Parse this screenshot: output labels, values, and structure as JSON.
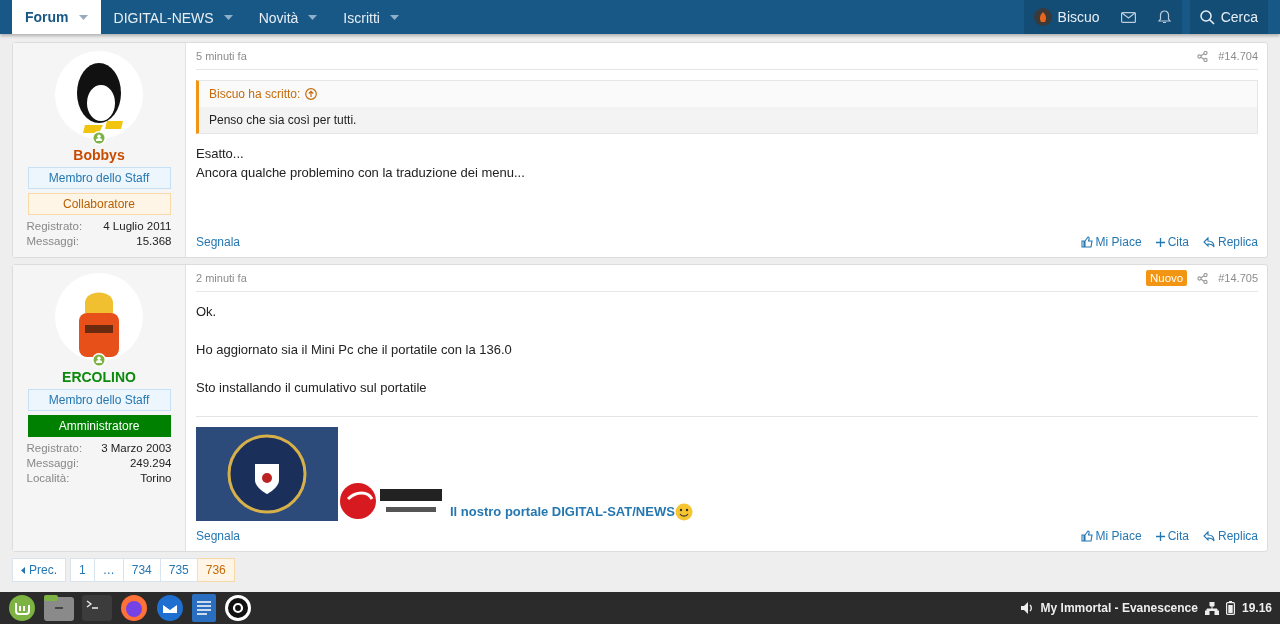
{
  "nav": {
    "tabs": [
      {
        "label": "Forum",
        "selected": true
      },
      {
        "label": "DIGITAL-NEWS",
        "selected": false
      },
      {
        "label": "Novità",
        "selected": false
      },
      {
        "label": "Iscritti",
        "selected": false
      }
    ],
    "user": {
      "name": "Biscuo"
    },
    "search": {
      "label": "Cerca"
    }
  },
  "posts": [
    {
      "author": {
        "name": "Bobbys",
        "color": "#c84b00",
        "online": true,
        "banners": [
          {
            "label": "Membro dello Staff",
            "kind": "staff"
          },
          {
            "label": "Collaboratore",
            "kind": "collab"
          }
        ],
        "stats": [
          {
            "label": "Registrato:",
            "value": "4 Luglio 2011"
          },
          {
            "label": "Messaggi:",
            "value": "15.368"
          }
        ]
      },
      "time": "5 minuti fa",
      "is_new": false,
      "number": "#14.704",
      "quote": {
        "author": "Biscuo ha scritto:",
        "text": "Penso che sia così per tutti."
      },
      "paragraphs": [
        "Esatto...\nAncora qualche problemino con la traduzione dei menu..."
      ],
      "actions": {
        "report": "Segnala",
        "like": "Mi Piace",
        "quote": "Cita",
        "reply": "Replica"
      }
    },
    {
      "author": {
        "name": "ERCOLINO",
        "color": "#0b8a0b",
        "online": true,
        "banners": [
          {
            "label": "Membro dello Staff",
            "kind": "staff"
          },
          {
            "label": "Amministratore",
            "kind": "admin"
          }
        ],
        "stats": [
          {
            "label": "Registrato:",
            "value": "3 Marzo 2003"
          },
          {
            "label": "Messaggi:",
            "value": "249.294"
          },
          {
            "label": "Località:",
            "value": "Torino"
          }
        ]
      },
      "time": "2 minuti fa",
      "is_new": true,
      "new_label": "Nuovo",
      "number": "#14.705",
      "paragraphs": [
        "Ok.",
        "Ho aggiornato sia il Mini Pc che il portatile con la 136.0",
        "Sto installando il cumulativo sul portatile"
      ],
      "signature": {
        "link": "Il nostro portale DIGITAL-SAT/NEWS"
      },
      "actions": {
        "report": "Segnala",
        "like": "Mi Piace",
        "quote": "Cita",
        "reply": "Replica"
      }
    }
  ],
  "pagination": {
    "prev": "Prec.",
    "pages": [
      {
        "label": "1",
        "selected": false
      },
      {
        "label": "…",
        "selected": false
      },
      {
        "label": "734",
        "selected": false
      },
      {
        "label": "735",
        "selected": false
      },
      {
        "label": "736",
        "selected": true
      }
    ]
  },
  "taskbar": {
    "now_playing": "My Immortal - Evanescence",
    "clock": "19.16"
  }
}
